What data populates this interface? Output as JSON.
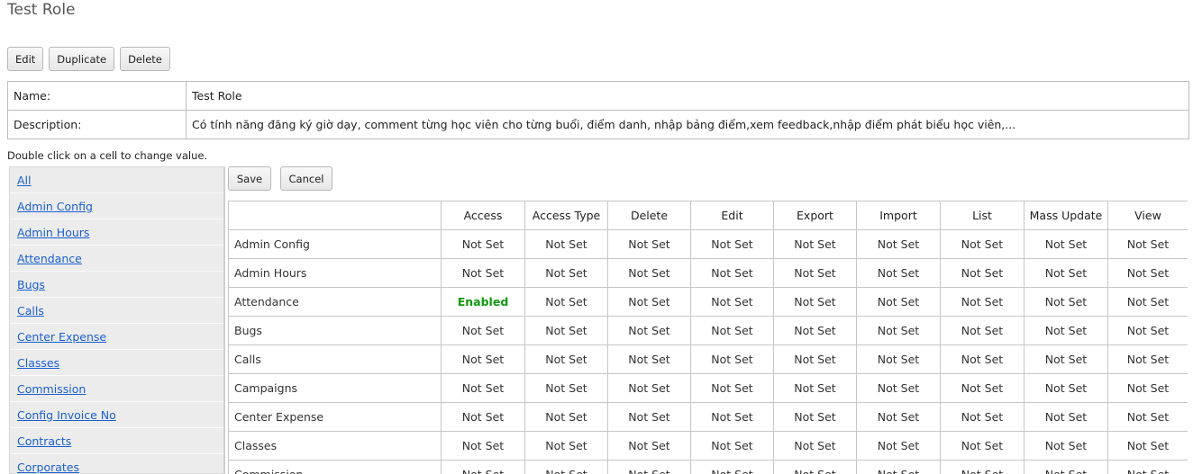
{
  "page": {
    "title": "Test Role"
  },
  "toolbar": {
    "edit_label": "Edit",
    "duplicate_label": "Duplicate",
    "delete_label": "Delete"
  },
  "info": {
    "name_label": "Name:",
    "name_value": "Test Role",
    "description_label": "Description:",
    "description_value": "Có tính năng đăng ký giờ dạy, comment từng học viên cho từng buổi, điểm danh, nhập bảng điểm,xem feedback,nhập điểm phát biểu học viên,..."
  },
  "hint": "Double click on a cell to change value.",
  "sidebar": {
    "items": [
      "All",
      "Admin Config",
      "Admin Hours",
      "Attendance",
      "Bugs",
      "Calls",
      "Center Expense",
      "Classes",
      "Commission",
      "Config Invoice No",
      "Contracts",
      "Corporates"
    ]
  },
  "actions": {
    "save_label": "Save",
    "cancel_label": "Cancel"
  },
  "permissions": {
    "columns": [
      "",
      "Access",
      "Access Type",
      "Delete",
      "Edit",
      "Export",
      "Import",
      "List",
      "Mass Update",
      "View"
    ],
    "rows": [
      {
        "name": "Admin Config",
        "values": [
          "Not Set",
          "Not Set",
          "Not Set",
          "Not Set",
          "Not Set",
          "Not Set",
          "Not Set",
          "Not Set",
          "Not Set"
        ]
      },
      {
        "name": "Admin Hours",
        "values": [
          "Not Set",
          "Not Set",
          "Not Set",
          "Not Set",
          "Not Set",
          "Not Set",
          "Not Set",
          "Not Set",
          "Not Set"
        ]
      },
      {
        "name": "Attendance",
        "values": [
          "Enabled",
          "Not Set",
          "Not Set",
          "Not Set",
          "Not Set",
          "Not Set",
          "Not Set",
          "Not Set",
          "Not Set"
        ]
      },
      {
        "name": "Bugs",
        "values": [
          "Not Set",
          "Not Set",
          "Not Set",
          "Not Set",
          "Not Set",
          "Not Set",
          "Not Set",
          "Not Set",
          "Not Set"
        ]
      },
      {
        "name": "Calls",
        "values": [
          "Not Set",
          "Not Set",
          "Not Set",
          "Not Set",
          "Not Set",
          "Not Set",
          "Not Set",
          "Not Set",
          "Not Set"
        ]
      },
      {
        "name": "Campaigns",
        "values": [
          "Not Set",
          "Not Set",
          "Not Set",
          "Not Set",
          "Not Set",
          "Not Set",
          "Not Set",
          "Not Set",
          "Not Set"
        ]
      },
      {
        "name": "Center Expense",
        "values": [
          "Not Set",
          "Not Set",
          "Not Set",
          "Not Set",
          "Not Set",
          "Not Set",
          "Not Set",
          "Not Set",
          "Not Set"
        ]
      },
      {
        "name": "Classes",
        "values": [
          "Not Set",
          "Not Set",
          "Not Set",
          "Not Set",
          "Not Set",
          "Not Set",
          "Not Set",
          "Not Set",
          "Not Set"
        ]
      },
      {
        "name": "Commission",
        "values": [
          "Not Set",
          "Not Set",
          "Not Set",
          "Not Set",
          "Not Set",
          "Not Set",
          "Not Set",
          "Not Set",
          "Not Set"
        ]
      }
    ]
  },
  "colors": {
    "link": "#1a5fd0",
    "enabled": "#119911"
  }
}
